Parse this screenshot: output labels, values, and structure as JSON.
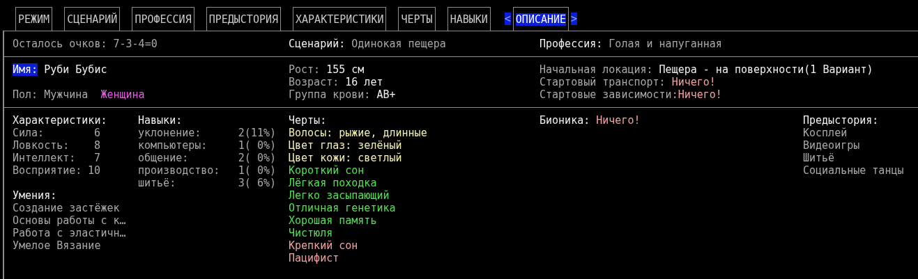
{
  "tabs": [
    {
      "label": "РЕЖИМ",
      "selected": false
    },
    {
      "label": "СЦЕНАРИЙ",
      "selected": false
    },
    {
      "label": "ПРОФЕССИЯ",
      "selected": false
    },
    {
      "label": "ПРЕДЫСТОРИЯ",
      "selected": false
    },
    {
      "label": "ХАРАКТЕРИСТИКИ",
      "selected": false
    },
    {
      "label": "ЧЕРТЫ",
      "selected": false
    },
    {
      "label": "НАВЫКИ",
      "selected": false
    },
    {
      "label": "ОПИСАНИЕ",
      "selected": true
    }
  ],
  "tab_nav": {
    "prev": "<",
    "next": ">"
  },
  "summary": {
    "points": {
      "label": "Осталось очков:",
      "value": "7-3-4=0"
    },
    "scenario": {
      "label": "Сценарий:",
      "value": "Одинокая пещера"
    },
    "profession": {
      "label": "Профессия:",
      "value": "Голая и напуганная"
    }
  },
  "identity": {
    "name": {
      "label": "Имя:",
      "value": "Руби Бубис",
      "focused": true
    },
    "gender": {
      "label": "Пол:",
      "options": [
        {
          "label": "Мужчина",
          "selected": false
        },
        {
          "label": "Женщина",
          "selected": true
        }
      ]
    },
    "height": {
      "label": "Рост:",
      "value": "155 см"
    },
    "age": {
      "label": "Возраст:",
      "value": "16 лет"
    },
    "blood": {
      "label": "Группа крови:",
      "value": "AB+"
    },
    "location": {
      "label": "Начальная локация:",
      "value": "Пещера - на поверхности(1 Вариант)"
    },
    "vehicle": {
      "label": "Стартовый транспорт:",
      "value": "Ничего!"
    },
    "addictions": {
      "label": "Стартовые зависимости:",
      "value": "Ничего!"
    }
  },
  "stats": {
    "title": "Характеристики:",
    "items": [
      {
        "name": "Сила:",
        "value": "6"
      },
      {
        "name": "Ловкость:",
        "value": "8"
      },
      {
        "name": "Интеллект:",
        "value": "7"
      },
      {
        "name": "Восприятие:",
        "value": "10"
      }
    ]
  },
  "skills": {
    "title": "Навыки:",
    "items": [
      {
        "name": "уклонение:",
        "value": "2(11%)"
      },
      {
        "name": "компьютеры:",
        "value": "1( 0%)"
      },
      {
        "name": "общение:",
        "value": "2( 0%)"
      },
      {
        "name": "производство:",
        "value": "1( 0%)"
      },
      {
        "name": "шитьё:",
        "value": "3( 6%)"
      }
    ]
  },
  "proficiencies": {
    "title": "Умения:",
    "items": [
      "Создание застёжек",
      "Основы работы с к…",
      "Работа с эластичн…",
      "Умелое Вязание"
    ]
  },
  "traits": {
    "title": "Черты:",
    "items": [
      {
        "label": "Волосы: рыжие, длинные",
        "kind": "appearance"
      },
      {
        "label": "Цвет глаз: зелёный",
        "kind": "appearance"
      },
      {
        "label": "Цвет кожи: светлый",
        "kind": "appearance"
      },
      {
        "label": "Короткий сон",
        "kind": "positive"
      },
      {
        "label": "Лёгкая походка",
        "kind": "positive"
      },
      {
        "label": "Легко засыпающий",
        "kind": "positive"
      },
      {
        "label": "Отличная генетика",
        "kind": "positive"
      },
      {
        "label": "Хорошая память",
        "kind": "positive"
      },
      {
        "label": "Чистюля",
        "kind": "positive"
      },
      {
        "label": "Крепкий сон",
        "kind": "negative"
      },
      {
        "label": "Пацифист",
        "kind": "negative"
      }
    ]
  },
  "bionics": {
    "label": "Бионика:",
    "value": "Ничего!"
  },
  "background": {
    "title": "Предыстория:",
    "items": [
      "Косплей",
      "Видеоигры",
      "Шитьё",
      "Социальные танцы"
    ]
  }
}
